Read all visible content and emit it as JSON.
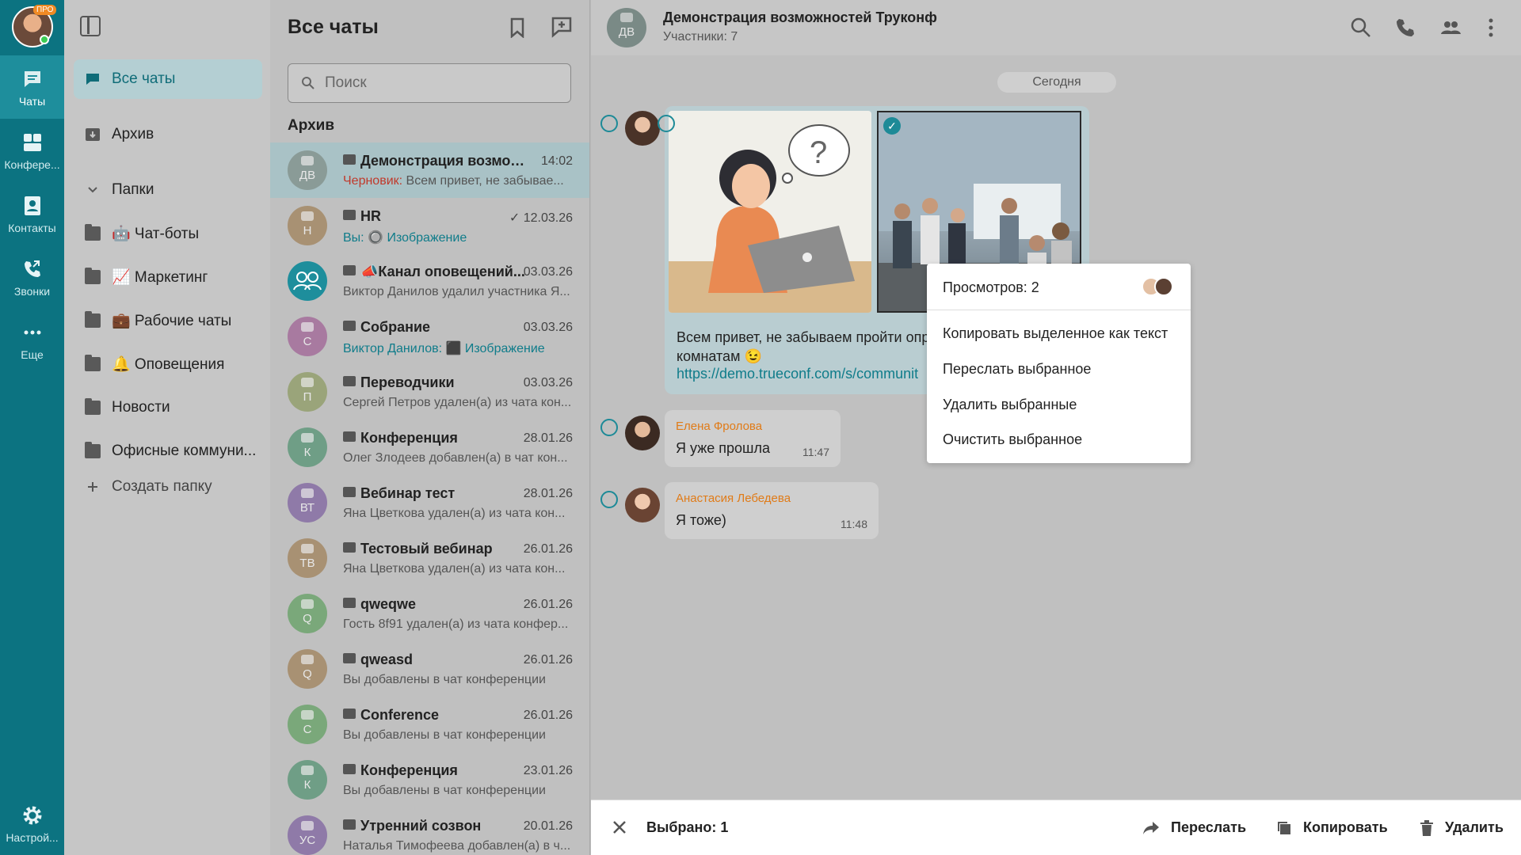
{
  "rail": {
    "pro_badge": "ПРО",
    "items": [
      {
        "label": "Чаты"
      },
      {
        "label": "Конфере..."
      },
      {
        "label": "Контакты"
      },
      {
        "label": "Звонки"
      },
      {
        "label": "Еще"
      },
      {
        "label": "Настрой..."
      }
    ]
  },
  "folders": {
    "items": [
      {
        "label": "Все чаты"
      },
      {
        "label": "Архив"
      },
      {
        "label": "Папки"
      },
      {
        "label": "🤖 Чат-боты"
      },
      {
        "label": "📈 Маркетинг"
      },
      {
        "label": "💼 Рабочие чаты"
      },
      {
        "label": "🔔 Оповещения"
      },
      {
        "label": "Новости"
      },
      {
        "label": "Офисные коммуни..."
      },
      {
        "label": "Создать папку"
      }
    ]
  },
  "chatlist": {
    "title": "Все чаты",
    "search_placeholder": "Поиск",
    "section": "Архив",
    "rows": [
      {
        "initials": "ДВ",
        "name": "Демонстрация возмож...",
        "date": "14:02",
        "draft": "Черновик:",
        "preview": " Всем привет, не забывае...",
        "color": "#8a9b97"
      },
      {
        "initials": "Н",
        "name": "HR",
        "date": "✓ 12.03.26",
        "prefix": "Вы:",
        "preview": " 🔘 Изображение",
        "color": "#a89173"
      },
      {
        "initials": "",
        "name": "📣Канал оповещений...",
        "date": "03.03.26",
        "preview": "Виктор Данилов удалил участника Я...",
        "color": "#1e8e9c"
      },
      {
        "initials": "С",
        "name": "Собрание",
        "date": "03.03.26",
        "prefix": "Виктор Данилов:",
        "preview": " ⬛ Изображение",
        "color": "#a87aa0"
      },
      {
        "initials": "П",
        "name": "Переводчики",
        "date": "03.03.26",
        "preview": "Сергей Петров удален(а) из чата кон...",
        "color": "#9aa47a"
      },
      {
        "initials": "К",
        "name": "Конференция",
        "date": "28.01.26",
        "preview": "Олег Злодеев добавлен(а) в чат кон...",
        "color": "#6f9e86"
      },
      {
        "initials": "ВТ",
        "name": "Вебинар тест",
        "date": "28.01.26",
        "preview": "Яна Цветкова удален(а) из чата кон...",
        "color": "#8f7aa8"
      },
      {
        "initials": "ТВ",
        "name": "Тестовый вебинар",
        "date": "26.01.26",
        "preview": "Яна Цветкова удален(а) из чата кон...",
        "color": "#a89173"
      },
      {
        "initials": "Q",
        "name": "qweqwe",
        "date": "26.01.26",
        "preview": "Гость 8f91 удален(а) из чата конфер...",
        "color": "#7aa87a"
      },
      {
        "initials": "Q",
        "name": "qweasd",
        "date": "26.01.26",
        "preview": "Вы добавлены в чат конференции",
        "color": "#a89173"
      },
      {
        "initials": "C",
        "name": "Conference",
        "date": "26.01.26",
        "preview": "Вы добавлены в чат конференции",
        "color": "#7aa87a"
      },
      {
        "initials": "К",
        "name": "Конференция",
        "date": "23.01.26",
        "preview": "Вы добавлены в чат конференции",
        "color": "#6f9e86"
      },
      {
        "initials": "УС",
        "name": "Утренний созвон",
        "date": "20.01.26",
        "preview": "Наталья Тимофеева добавлен(а) в ч...",
        "color": "#8f7aa8"
      }
    ]
  },
  "chat": {
    "avatar": "ДВ",
    "name": "Демонстрация возможностей Труконф",
    "members": "Участники: 7",
    "date_pill": "Сегодня",
    "main_text_1": "Всем привет, не забываем пройти опр",
    "main_text_2": "комнатам 😉",
    "main_link": "https://demo.trueconf.com/s/communit",
    "messages": [
      {
        "sender": "Елена Фролова",
        "text": "Я уже прошла",
        "time": "11:47"
      },
      {
        "sender": "Анастасия Лебедева",
        "text": "Я тоже)",
        "time": "11:48"
      }
    ]
  },
  "context_menu": {
    "views": "Просмотров: 2",
    "items": [
      "Копировать выделенное как текст",
      "Переслать выбранное",
      "Удалить выбранные",
      "Очистить выбранное"
    ]
  },
  "selection_bar": {
    "count": "Выбрано: 1",
    "forward": "Переслать",
    "copy": "Копировать",
    "delete": "Удалить"
  },
  "colors": {
    "accent": "#0c7381",
    "link": "#0f7c8a",
    "sender": "#e07b18",
    "draft": "#c0392b"
  }
}
